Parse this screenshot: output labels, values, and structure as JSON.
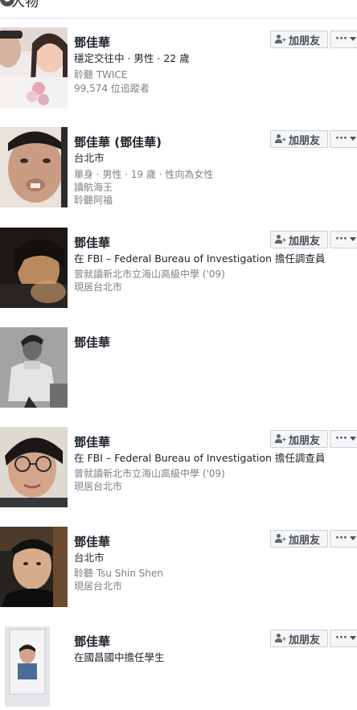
{
  "section": {
    "title": "人物"
  },
  "buttons": {
    "add_friend": "加朋友",
    "more": "···"
  },
  "results": [
    {
      "name": "鄧佳華",
      "line1": "穩定交往中 · 男性 · 22 歲",
      "line2": "聆聽 TWICE",
      "line3": "99,574 位追蹤者",
      "has_actions": true
    },
    {
      "name": "鄧佳華 (鄧佳華)",
      "line1": "台北市",
      "line2": "單身 · 男性 · 19 歲 · 性向為女性",
      "line3": "讀航海王",
      "line4": "聆聽阿福",
      "has_actions": true
    },
    {
      "name": "鄧佳華",
      "line1": "在 FBI – Federal Bureau of Investigation 擔任調查員",
      "line2": "曾就讀新北市立海山高級中學 ('09)",
      "line3": "現居台北市",
      "has_actions": true
    },
    {
      "name": "鄧佳華",
      "has_actions": false
    },
    {
      "name": "鄧佳華",
      "line1": "在 FBI – Federal Bureau of Investigation 擔任調查員",
      "line2": "曾就讀新北市立海山高級中學 ('09)",
      "line3": "現居台北市",
      "has_actions": true
    },
    {
      "name": "鄧佳華",
      "line1": "台北市",
      "line2": "聆聽 Tsu Shin Shen",
      "line3": "現居台北市",
      "has_actions": true
    },
    {
      "name": "鄧佳華",
      "line1": "在國昌國中擔任學生",
      "has_actions": true
    }
  ]
}
